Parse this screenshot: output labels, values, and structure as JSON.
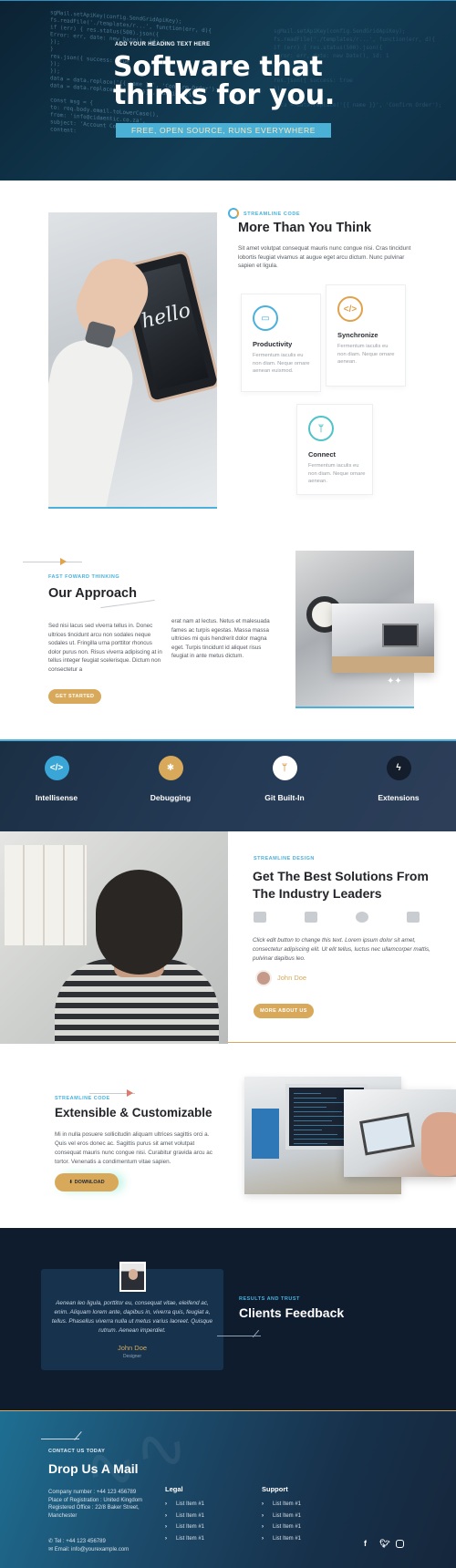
{
  "hero": {
    "eyebrow": "ADD YOUR HEADING TEXT HERE",
    "title": "Software that thinks for you.",
    "subtitle": "FREE, OPEN SOURCE, RUNS EVERYWHERE",
    "code_lines": [
      "sgMail.setApiKey(config.SendGridApiKey);",
      "fs.readFile('./templates/r...', function(err, d){",
      "  if (err) { res.status(500).json({",
      "      Error: err, date: new Date(), id: 1",
      "    });",
      "  }",
      "  res.json({ success: true",
      "  });",
      "});",
      "data = data.replace('{{ name }}', 'Confirm Order');",
      "data = data.replace('{{ url }}', config.url);",
      "",
      "const msg = {",
      "  to: req.body.email.toLowerCase(),",
      "  from: 'info@cidaentic.co.za',",
      "  subject: 'Account Confirmation',",
      "  content:"
    ]
  },
  "intro": {
    "eyebrow": "STREAMLINE CODE",
    "title": "More Than You Think",
    "text": "Sit amet volutpat consequat mauris nunc congue nisi. Cras tincidunt lobortis feugiat vivamus at augue eget arcu dictum. Nunc pulvinar sapien et ligula.",
    "phone_text": "hello",
    "cards": [
      {
        "title": "Productivity",
        "desc": "Fermentum iaculis eu non diam. Neque ornare aenean euismod.",
        "icon": "laptop-icon",
        "color": "#4ab0dc"
      },
      {
        "title": "Synchronize",
        "desc": "Fermentum iaculis eu non diam. Neque ornare aenean.",
        "icon": "code-icon",
        "color": "#e0a24a"
      },
      {
        "title": "Connect",
        "desc": "Fermentum iaculis eu non diam. Neque ornare aenean.",
        "icon": "git-branch-icon",
        "color": "#4fc3c8"
      }
    ]
  },
  "approach": {
    "eyebrow": "FAST FOWARD THINKING",
    "title": "Our Approach",
    "col1": "Sed nisi lacus sed viverra tellus in. Donec ultrices tincidunt arcu non sodales neque sodales ut. Fringilla urna porttitor rhoncus dolor purus non. Risus viverra adipiscing at in tellus integer feugiat scelerisque. Dictum non consectetur a",
    "col2": "erat nam at lectus. Netus et malesuada fames ac turpis egestas. Massa massa ultricies mi quis hendrerit dolor magna eget. Turpis tincidunt id aliquet risus feugiat in ante metus dictum.",
    "button": "GET STARTED"
  },
  "features": [
    {
      "label": "Intellisense",
      "icon": "code-icon",
      "color": "#3aa6d8"
    },
    {
      "label": "Debugging",
      "icon": "bug-icon",
      "color": "#d8a95a"
    },
    {
      "label": "Git Built-In",
      "icon": "git-branch-icon",
      "color": "#ffffff"
    },
    {
      "label": "Extensions",
      "icon": "bolt-icon",
      "color": "#131d2b"
    }
  ],
  "solutions": {
    "eyebrow": "STREAMLINE DESIGN",
    "title": "Get The Best Solutions From The Industry Leaders",
    "quote": "Click edit button to change this text. Lorem ipsum dolor sit amet, consectetur adipiscing elit. Ut elit tellus, luctus nec ullamcorper mattis, pulvinar dapibus leo.",
    "name": "John Doe",
    "button": "MORE ABOUT US"
  },
  "extensible": {
    "eyebrow": "STREAMLINE CODE",
    "title": "Extensible & Customizable",
    "text": "Mi in nulla posuere sollicitudin aliquam ultrices sagittis orci a. Quis vel eros donec ac. Sagittis purus sit amet volutpat consequat mauris nunc congue nisi. Curabitur gravida arcu ac tortor. Venenatis a condimentum vitae sapien.",
    "button": "DOWNLOAD"
  },
  "feedback": {
    "quote": "Aenean leo ligula, porttitor eu, consequat vitae, eleifend ac, enim. Aliquam lorem ante, dapibus in, viverra quis, feugiat a, tellus. Phasellus viverra nulla ut metus varius laoreet. Quisque rutrum. Aenean imperdiet.",
    "name": "John Doe",
    "role": "Designer",
    "eyebrow": "RESULTS AND TRUST",
    "title": "Clients Feedback"
  },
  "footer": {
    "eyebrow": "CONTACT US TODAY",
    "title": "Drop Us A Mail",
    "info": "Company number : +44 123 456789\nPlace of Registration : United Kingdom\nRegistered Office : 22/8 Baker Street, Manchester",
    "phone": "Tel : +44 123 456789",
    "email": "Email: info@yourexample.com",
    "legal_title": "Legal",
    "support_title": "Support",
    "legal_items": [
      "List Item #1",
      "List Item #1",
      "List Item #1",
      "List Item #1"
    ],
    "support_items": [
      "List Item #1",
      "List Item #1",
      "List Item #1",
      "List Item #1"
    ],
    "social": [
      "facebook-icon",
      "twitter-icon",
      "instagram-icon"
    ]
  }
}
